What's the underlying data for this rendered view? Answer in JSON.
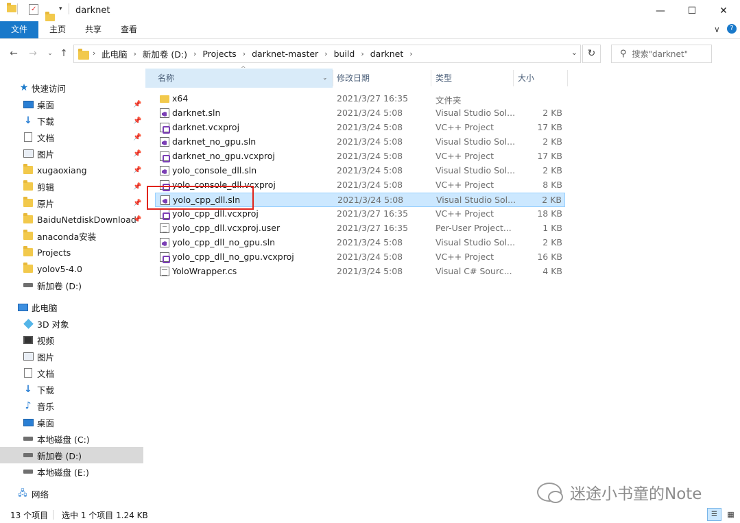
{
  "window": {
    "title": "darknet",
    "minimize_glyph": "—",
    "maximize_glyph": "☐",
    "close_glyph": "✕"
  },
  "ribbon": {
    "tabs": [
      "文件",
      "主页",
      "共享",
      "查看"
    ],
    "expand_glyph": "∨",
    "help_glyph": "?"
  },
  "address": {
    "crumbs": [
      "此电脑",
      "新加卷 (D:)",
      "Projects",
      "darknet-master",
      "build",
      "darknet"
    ],
    "search_placeholder": "搜索\"darknet\""
  },
  "nav_pane": {
    "quick_access": "快速访问",
    "quick_items": [
      {
        "label": "桌面",
        "icon": "desktop-icon",
        "pinned": true
      },
      {
        "label": "下载",
        "icon": "download-icon",
        "pinned": true
      },
      {
        "label": "文档",
        "icon": "document-icon",
        "pinned": true
      },
      {
        "label": "图片",
        "icon": "picture-icon",
        "pinned": true
      },
      {
        "label": "xugaoxiang",
        "icon": "folder-icon",
        "pinned": true
      },
      {
        "label": "剪辑",
        "icon": "folder-icon",
        "pinned": true
      },
      {
        "label": "原片",
        "icon": "folder-icon",
        "pinned": true
      },
      {
        "label": "BaiduNetdiskDownload",
        "icon": "folder-icon",
        "pinned": true
      },
      {
        "label": "anaconda安装",
        "icon": "folder-icon",
        "pinned": false
      },
      {
        "label": "Projects",
        "icon": "folder-icon",
        "pinned": false
      },
      {
        "label": "yolov5-4.0",
        "icon": "folder-icon",
        "pinned": false
      },
      {
        "label": "新加卷 (D:)",
        "icon": "drive-icon",
        "pinned": false
      }
    ],
    "this_pc": "此电脑",
    "pc_items": [
      {
        "label": "3D 对象",
        "icon": "3d-objects-icon"
      },
      {
        "label": "视频",
        "icon": "video-icon"
      },
      {
        "label": "图片",
        "icon": "picture-icon"
      },
      {
        "label": "文档",
        "icon": "document-icon"
      },
      {
        "label": "下载",
        "icon": "download-icon"
      },
      {
        "label": "音乐",
        "icon": "music-icon"
      },
      {
        "label": "桌面",
        "icon": "desktop-icon"
      },
      {
        "label": "本地磁盘 (C:)",
        "icon": "drive-icon"
      },
      {
        "label": "新加卷 (D:)",
        "icon": "drive-icon",
        "selected": true
      },
      {
        "label": "本地磁盘 (E:)",
        "icon": "drive-icon"
      }
    ],
    "network": "网络"
  },
  "columns": {
    "name": "名称",
    "date": "修改日期",
    "type": "类型",
    "size": "大小"
  },
  "files": [
    {
      "name": "x64",
      "date": "2021/3/27 16:35",
      "type": "文件夹",
      "size": "",
      "kind": "folder"
    },
    {
      "name": "darknet.sln",
      "date": "2021/3/24 5:08",
      "type": "Visual Studio Sol...",
      "size": "2 KB",
      "kind": "sln"
    },
    {
      "name": "darknet.vcxproj",
      "date": "2021/3/24 5:08",
      "type": "VC++ Project",
      "size": "17 KB",
      "kind": "proj"
    },
    {
      "name": "darknet_no_gpu.sln",
      "date": "2021/3/24 5:08",
      "type": "Visual Studio Sol...",
      "size": "2 KB",
      "kind": "sln"
    },
    {
      "name": "darknet_no_gpu.vcxproj",
      "date": "2021/3/24 5:08",
      "type": "VC++ Project",
      "size": "17 KB",
      "kind": "proj"
    },
    {
      "name": "yolo_console_dll.sln",
      "date": "2021/3/24 5:08",
      "type": "Visual Studio Sol...",
      "size": "2 KB",
      "kind": "sln"
    },
    {
      "name": "yolo_console_dll.vcxproj",
      "date": "2021/3/24 5:08",
      "type": "VC++ Project",
      "size": "8 KB",
      "kind": "proj"
    },
    {
      "name": "yolo_cpp_dll.sln",
      "date": "2021/3/24 5:08",
      "type": "Visual Studio Sol...",
      "size": "2 KB",
      "kind": "sln",
      "selected": true
    },
    {
      "name": "yolo_cpp_dll.vcxproj",
      "date": "2021/3/27 16:35",
      "type": "VC++ Project",
      "size": "18 KB",
      "kind": "proj"
    },
    {
      "name": "yolo_cpp_dll.vcxproj.user",
      "date": "2021/3/27 16:35",
      "type": "Per-User Project...",
      "size": "1 KB",
      "kind": "user"
    },
    {
      "name": "yolo_cpp_dll_no_gpu.sln",
      "date": "2021/3/24 5:08",
      "type": "Visual Studio Sol...",
      "size": "2 KB",
      "kind": "sln"
    },
    {
      "name": "yolo_cpp_dll_no_gpu.vcxproj",
      "date": "2021/3/24 5:08",
      "type": "VC++ Project",
      "size": "16 KB",
      "kind": "proj"
    },
    {
      "name": "YoloWrapper.cs",
      "date": "2021/3/24 5:08",
      "type": "Visual C# Sourc...",
      "size": "4 KB",
      "kind": "cs"
    }
  ],
  "status": {
    "count": "13 个项目",
    "selection": "选中 1 个项目  1.24 KB"
  },
  "watermark": "迷途小书童的Note",
  "colors": {
    "file_tab": "#1979ca",
    "selection": "#cce8ff",
    "highlight_box": "#e0241b"
  }
}
